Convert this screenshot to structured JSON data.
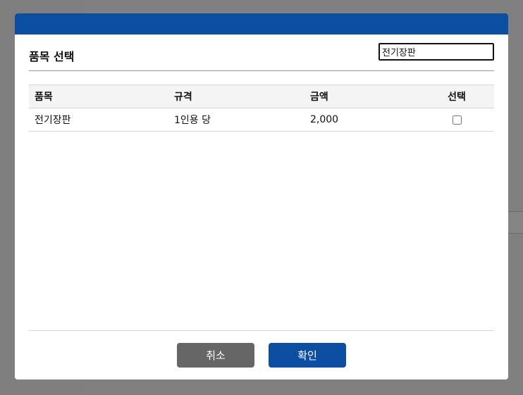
{
  "modal": {
    "title": "품목 선택",
    "search": {
      "value": "전기장판",
      "placeholder": ""
    },
    "table": {
      "headers": {
        "name": "품목",
        "spec": "규격",
        "amount": "금액",
        "select": "선택"
      },
      "rows": [
        {
          "name": "전기장판",
          "spec": "1인용 당",
          "amount": "2,000",
          "selected": false
        }
      ]
    },
    "buttons": {
      "cancel": "취소",
      "ok": "확인"
    }
  },
  "colors": {
    "header_bar": "#0b4ea2",
    "ok_button": "#0b4ea2",
    "cancel_button": "#666666"
  }
}
